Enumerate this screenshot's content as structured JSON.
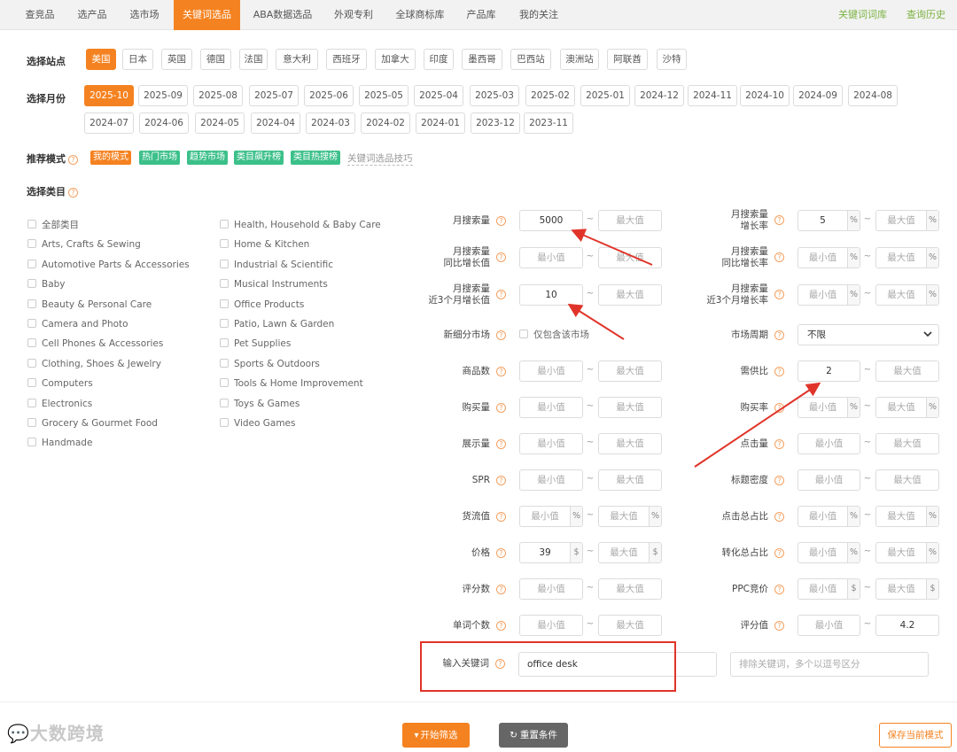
{
  "nav": {
    "tabs": [
      "查竞品",
      "选产品",
      "选市场",
      "关键词选品",
      "ABA数据选品",
      "外观专利",
      "全球商标库",
      "产品库",
      "我的关注"
    ],
    "active_index": 3,
    "right_links": [
      "关键词词库",
      "查询历史"
    ]
  },
  "site": {
    "label": "选择站点",
    "options": [
      "美国",
      "日本",
      "英国",
      "德国",
      "法国",
      "意大利",
      "西班牙",
      "加拿大",
      "印度",
      "墨西哥",
      "巴西站",
      "澳洲站",
      "阿联酋",
      "沙特"
    ],
    "selected": "美国"
  },
  "month": {
    "label": "选择月份",
    "options": [
      "2025-10",
      "2025-09",
      "2025-08",
      "2025-07",
      "2025-06",
      "2025-05",
      "2025-04",
      "2025-03",
      "2025-02",
      "2025-01",
      "2024-12",
      "2024-11",
      "2024-10",
      "2024-09",
      "2024-08",
      "2024-07",
      "2024-06",
      "2024-05",
      "2024-04",
      "2024-03",
      "2024-02",
      "2024-01",
      "2023-12",
      "2023-11"
    ],
    "selected": "2025-10"
  },
  "mode": {
    "label": "推荐模式",
    "tags": [
      "我的模式",
      "热门市场",
      "趋势市场",
      "类目飙升榜",
      "类目热搜榜"
    ],
    "tip_link": "关键词选品技巧"
  },
  "category": {
    "label": "选择类目",
    "col1": [
      "全部类目",
      "Arts, Crafts & Sewing",
      "Automotive Parts & Accessories",
      "Baby",
      "Beauty & Personal Care",
      "Camera and Photo",
      "Cell Phones & Accessories",
      "Clothing, Shoes & Jewelry",
      "Computers",
      "Electronics",
      "Grocery & Gourmet Food",
      "Handmade"
    ],
    "col2": [
      "Health, Household & Baby Care",
      "Home & Kitchen",
      "Industrial & Scientific",
      "Musical Instruments",
      "Office Products",
      "Patio, Lawn & Garden",
      "Pet Supplies",
      "Sports & Outdoors",
      "Tools & Home Improvement",
      "Toys & Games",
      "Video Games"
    ]
  },
  "placeholders": {
    "min": "最小值",
    "max": "最大值"
  },
  "filters": {
    "monthly_search": {
      "label": "月搜索量",
      "min": "5000"
    },
    "monthly_growth": {
      "label_l1": "月搜索量",
      "label_l2": "增长率",
      "min": "5",
      "unit": "%"
    },
    "yoy_growth": {
      "label_l1": "月搜索量",
      "label_l2": "同比增长值"
    },
    "yoy_growth_rate": {
      "label_l1": "月搜索量",
      "label_l2": "同比增长率",
      "unit": "%"
    },
    "recent3_growth": {
      "label_l1": "月搜索量",
      "label_l2": "近3个月增长值",
      "min": "10"
    },
    "recent3_growth_rate": {
      "label_l1": "月搜索量",
      "label_l2": "近3个月增长率",
      "unit": "%"
    },
    "new_market": {
      "label": "新细分市场",
      "checkbox_label": "仅包含该市场"
    },
    "market_cycle": {
      "label": "市场周期",
      "value": "不限"
    },
    "products": {
      "label": "商品数"
    },
    "supply_demand": {
      "label": "需供比",
      "min": "2"
    },
    "purchases": {
      "label": "购买量"
    },
    "purchase_rate": {
      "label": "购买率",
      "unit": "%"
    },
    "impressions": {
      "label": "展示量"
    },
    "clicks": {
      "label": "点击量"
    },
    "spr": {
      "label": "SPR"
    },
    "title_density": {
      "label": "标题密度"
    },
    "flow_value": {
      "label": "货流值",
      "unit": "%"
    },
    "click_share": {
      "label": "点击总占比",
      "unit": "%"
    },
    "price": {
      "label": "价格",
      "min": "39",
      "unit": "$"
    },
    "conversion_share": {
      "label": "转化总占比",
      "unit": "%"
    },
    "reviews": {
      "label": "评分数"
    },
    "ppc": {
      "label": "PPC竞价",
      "unit": "$"
    },
    "word_count": {
      "label": "单词个数"
    },
    "rating": {
      "label": "评分值",
      "max": "4.2"
    }
  },
  "keyword": {
    "label": "输入关键词",
    "value": "office desk",
    "exclude_placeholder": "排除关键词，多个以逗号区分"
  },
  "actions": {
    "start": "开始筛选",
    "reset": "重置条件",
    "save": "保存当前模式"
  },
  "watermark": "大数跨境",
  "colors": {
    "accent": "#f58220",
    "green": "#3cc08a",
    "link_green": "#7cb342",
    "annotation_red": "#e0342a"
  }
}
